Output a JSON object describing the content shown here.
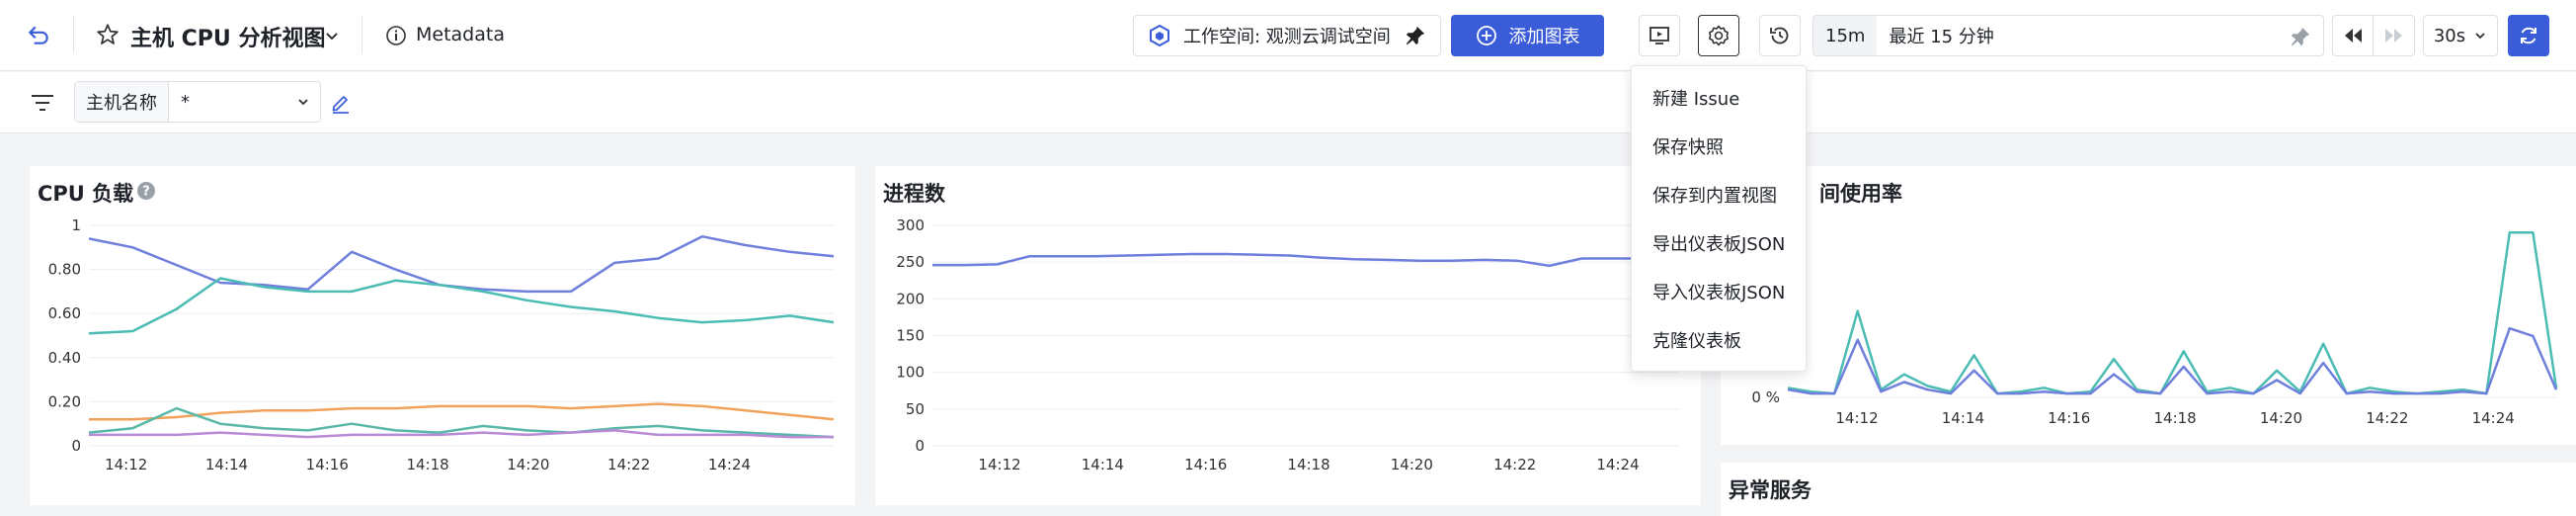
{
  "header": {
    "title": "主机 CPU 分析视图",
    "metadata_label": "Metadata",
    "workspace_label": "工作空间: 观测云调试空间",
    "add_chart_label": "添加图表",
    "time_short": "15m",
    "time_range": "最近 15 分钟",
    "refresh_interval": "30s"
  },
  "filter": {
    "label": "主机名称",
    "value": "*"
  },
  "menu": {
    "items": [
      "新建 Issue",
      "保存快照",
      "保存到内置视图",
      "导出仪表板JSON",
      "导入仪表板JSON",
      "克隆仪表板"
    ]
  },
  "panels": {
    "cpu": {
      "title": "CPU 负载"
    },
    "proc": {
      "title": "进程数"
    },
    "disk": {
      "title": "间使用率"
    },
    "abnormal": {
      "title": "异常服务"
    }
  },
  "colors": {
    "accent": "#3a5cd8",
    "series_blue": "#6f7fdc",
    "series_teal": "#4bbcb3",
    "series_orange": "#f0a25c"
  },
  "chart_data": [
    {
      "type": "line",
      "title": "CPU 负载",
      "x": [
        "14:12",
        "14:14",
        "14:16",
        "14:18",
        "14:20",
        "14:22",
        "14:24"
      ],
      "yticks": [
        "0",
        "0.20",
        "0.40",
        "0.60",
        "0.80",
        "1"
      ],
      "ylim": [
        0,
        1
      ],
      "series": [
        {
          "values": [
            0.94,
            0.9,
            0.82,
            0.74,
            0.73,
            0.71,
            0.88,
            0.8,
            0.73,
            0.71,
            0.7,
            0.7,
            0.83,
            0.85,
            0.95,
            0.91,
            0.88,
            0.86
          ]
        },
        {
          "values": [
            0.51,
            0.52,
            0.62,
            0.76,
            0.72,
            0.7,
            0.7,
            0.75,
            0.73,
            0.7,
            0.66,
            0.63,
            0.61,
            0.58,
            0.56,
            0.57,
            0.59,
            0.56
          ]
        },
        {
          "values": [
            0.12,
            0.12,
            0.13,
            0.15,
            0.16,
            0.16,
            0.17,
            0.17,
            0.18,
            0.18,
            0.18,
            0.17,
            0.18,
            0.19,
            0.18,
            0.16,
            0.14,
            0.12
          ]
        },
        {
          "values": [
            0.06,
            0.08,
            0.17,
            0.1,
            0.08,
            0.07,
            0.1,
            0.07,
            0.06,
            0.09,
            0.07,
            0.06,
            0.08,
            0.09,
            0.07,
            0.06,
            0.05,
            0.04
          ]
        },
        {
          "values": [
            0.05,
            0.05,
            0.05,
            0.06,
            0.05,
            0.04,
            0.05,
            0.05,
            0.05,
            0.06,
            0.05,
            0.06,
            0.07,
            0.05,
            0.05,
            0.05,
            0.04,
            0.04
          ]
        }
      ]
    },
    {
      "type": "line",
      "title": "进程数",
      "x": [
        "14:12",
        "14:14",
        "14:16",
        "14:18",
        "14:20",
        "14:22",
        "14:24"
      ],
      "yticks": [
        "0",
        "50",
        "100",
        "150",
        "200",
        "250",
        "300"
      ],
      "ylim": [
        0,
        300
      ],
      "series": [
        {
          "values": [
            246,
            246,
            247,
            258,
            258,
            258,
            259,
            260,
            261,
            261,
            260,
            259,
            256,
            254,
            253,
            252,
            252,
            253,
            252,
            245,
            255,
            255,
            255,
            256
          ]
        }
      ]
    },
    {
      "type": "line",
      "title": "间使用率",
      "x": [
        "14:12",
        "14:14",
        "14:16",
        "14:18",
        "14:20",
        "14:22",
        "14:24"
      ],
      "yticks": [
        "0 %"
      ],
      "series": [
        {
          "values": [
            5,
            3,
            2,
            45,
            4,
            12,
            6,
            3,
            22,
            2,
            3,
            5,
            2,
            3,
            20,
            4,
            2,
            24,
            3,
            5,
            2,
            14,
            3,
            28,
            2,
            5,
            3,
            2,
            3,
            4,
            2,
            86,
            86,
            5
          ]
        },
        {
          "values": [
            4,
            2,
            2,
            30,
            3,
            8,
            4,
            2,
            14,
            2,
            2,
            3,
            2,
            2,
            12,
            3,
            2,
            16,
            2,
            3,
            2,
            9,
            2,
            18,
            2,
            3,
            2,
            2,
            2,
            3,
            2,
            36,
            32,
            4
          ]
        }
      ]
    }
  ]
}
